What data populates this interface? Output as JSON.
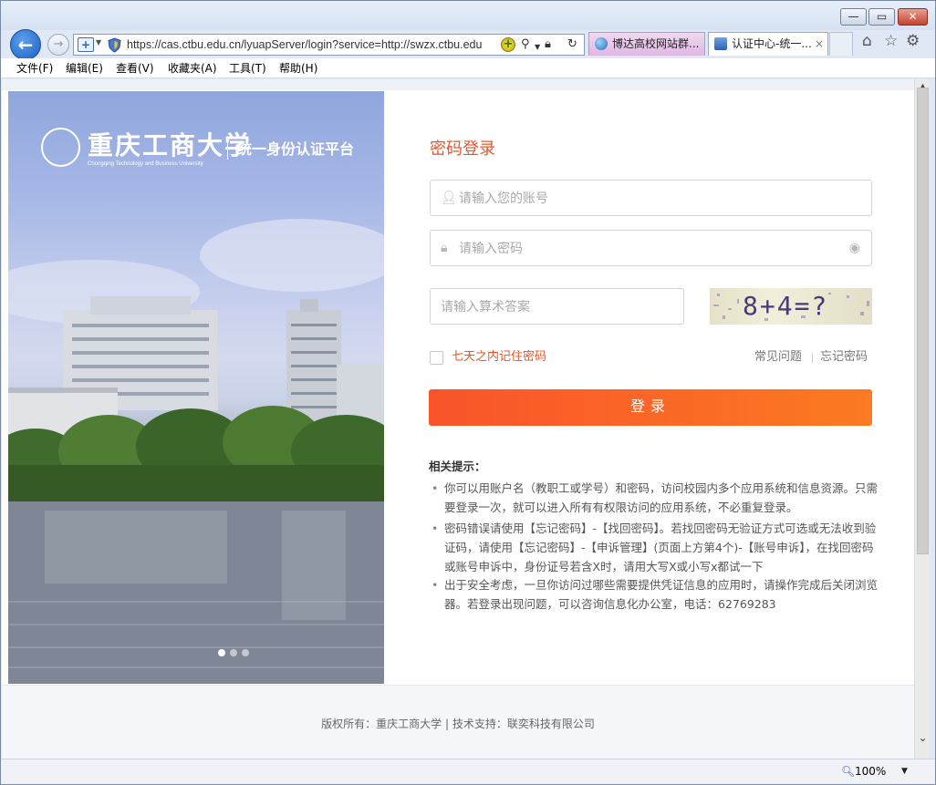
{
  "browser": {
    "url": "https://cas.ctbu.edu.cn/lyuapServer/login?service=http://swzx.ctbu.edu",
    "tabs": [
      {
        "label": "博达高校网站群..."
      },
      {
        "label": "认证中心-统一..."
      }
    ],
    "tab_close": "×",
    "menu": [
      "文件(F)",
      "编辑(E)",
      "查看(V)",
      "收藏夹(A)",
      "工具(T)",
      "帮助(H)"
    ],
    "zoom": "100%",
    "icons": {
      "back": "back-arrow-icon",
      "forward": "forward-arrow-icon",
      "search": "search-icon",
      "lock": "lock-icon",
      "refresh": "refresh-icon",
      "home": "home-icon",
      "favorites": "star-icon",
      "settings": "gear-icon"
    }
  },
  "hero": {
    "school_name": "重庆工商大学",
    "school_name_en": "Chongqing Technology and Business University",
    "platform": "统一身份认证平台",
    "slide_count": 3,
    "active_slide": 1
  },
  "login": {
    "title": "密码登录",
    "account_placeholder": "请输入您的账号",
    "password_placeholder": "请输入密码",
    "captcha_placeholder": "请输入算术答案",
    "captcha_text": "8+4=?",
    "remember_label": "七天之内记住密码",
    "faq_link": "常见问题",
    "forgot_link": "忘记密码",
    "submit_label": "登录"
  },
  "tips": {
    "title": "相关提示：",
    "items": [
      "你可以用账户名（教职工或学号）和密码，访问校园内多个应用系统和信息资源。只需要登录一次，就可以进入所有有权限访问的应用系统，不必重复登录。",
      "密码错误请使用【忘记密码】-【找回密码】。若找回密码无验证方式可选或无法收到验证码，请使用【忘记密码】-【申诉管理】(页面上方第4个)-【账号申诉】，在找回密码或账号申诉中，身份证号若含X时，请用大写X或小写x都试一下",
      "出于安全考虑，一旦你访问过哪些需要提供凭证信息的应用时，请操作完成后关闭浏览器。若登录出现问题，可以咨询信息化办公室，电话：62769283"
    ]
  },
  "footer": {
    "text": "版权所有：重庆工商大学 | 技术支持：联奕科技有限公司"
  },
  "colors": {
    "accent": "#e5562a",
    "button_start": "#f9542a",
    "button_end": "#fb7a22"
  }
}
